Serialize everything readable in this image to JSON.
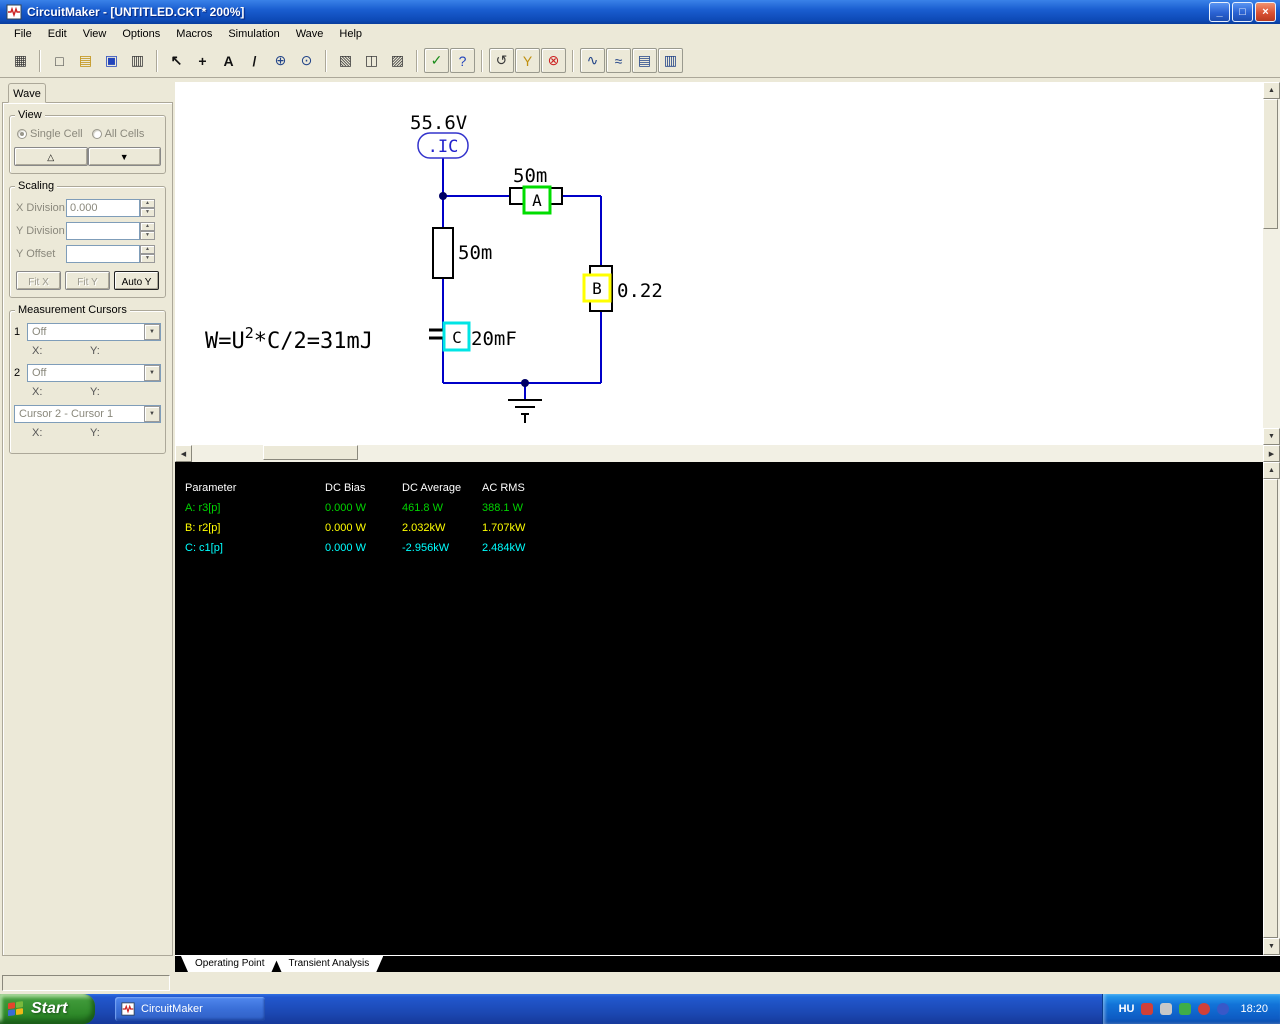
{
  "window": {
    "title": "CircuitMaker - [UNTITLED.CKT* 200%]",
    "controls": {
      "minimize": "_",
      "maximize": "□",
      "close": "×"
    }
  },
  "menu": {
    "items": [
      "File",
      "Edit",
      "View",
      "Options",
      "Macros",
      "Simulation",
      "Wave",
      "Help"
    ]
  },
  "toolbar": {
    "buttons": [
      {
        "icon": "parts-browser-icon",
        "glyph": "▦"
      },
      {
        "icon": "new-file-icon",
        "glyph": "□"
      },
      {
        "icon": "open-file-icon",
        "glyph": "▤"
      },
      {
        "icon": "save-icon",
        "glyph": "▣"
      },
      {
        "icon": "print-icon",
        "glyph": "▥"
      },
      {
        "icon": "arrow-tool-icon",
        "glyph": "↖"
      },
      {
        "icon": "wire-tool-icon",
        "glyph": "+"
      },
      {
        "icon": "text-tool-icon",
        "glyph": "A"
      },
      {
        "icon": "delete-tool-icon",
        "glyph": "/"
      },
      {
        "icon": "zoom-in-icon",
        "glyph": "⊕"
      },
      {
        "icon": "magnifier-icon",
        "glyph": "⊙"
      },
      {
        "icon": "fit-page-icon",
        "glyph": "▧"
      },
      {
        "icon": "split-view-icon",
        "glyph": "◫"
      },
      {
        "icon": "macro-icon",
        "glyph": "▨"
      },
      {
        "icon": "simulation-check-icon",
        "glyph": "✓"
      },
      {
        "icon": "help-icon",
        "glyph": "?"
      },
      {
        "icon": "reset-icon",
        "glyph": "↺"
      },
      {
        "icon": "probe-icon",
        "glyph": "Y"
      },
      {
        "icon": "stop-icon",
        "glyph": "⊗"
      },
      {
        "icon": "scope-icon",
        "glyph": "∿"
      },
      {
        "icon": "waveform-icon",
        "glyph": "≈"
      },
      {
        "icon": "analysis-icon",
        "glyph": "▤"
      },
      {
        "icon": "digital-display-icon",
        "glyph": "▥"
      }
    ]
  },
  "sidebar": {
    "tab": "Wave",
    "view": {
      "label": "View",
      "options": [
        {
          "label": "Single Cell",
          "selected": true
        },
        {
          "label": "All Cells",
          "selected": false
        }
      ],
      "up_glyph": "△",
      "down_glyph": "▼"
    },
    "scaling": {
      "label": "Scaling",
      "fields": [
        {
          "label": "X Division",
          "value": "0.000"
        },
        {
          "label": "Y Division",
          "value": ""
        },
        {
          "label": "Y Offset",
          "value": ""
        }
      ],
      "buttons": [
        {
          "label": "Fit X",
          "enabled": false
        },
        {
          "label": "Fit Y",
          "enabled": false
        },
        {
          "label": "Auto Y",
          "enabled": true
        }
      ]
    },
    "cursors": {
      "label": "Measurement Cursors",
      "cursor1": {
        "num": "1",
        "value": "Off"
      },
      "cursor2": {
        "num": "2",
        "value": "Off"
      },
      "diff_value": "Cursor 2 - Cursor 1",
      "x_label": "X:",
      "y_label": "Y:"
    }
  },
  "circuit": {
    "source_value": "55.6V",
    "ic_label": ".IC",
    "r_top_ref": "A",
    "r_top_value": "50m",
    "r_left_value": "50m",
    "r_right_ref": "B",
    "r_right_value": "0.22",
    "cap_ref": "C",
    "cap_value": "20mF",
    "annotation": {
      "pre": "W=U",
      "sup": "2",
      "post": "*C/2=31mJ"
    },
    "colors": {
      "wire": "#0000C8",
      "ref_a": "#00dd00",
      "ref_b": "#ffff00",
      "ref_c": "#00e5e5"
    }
  },
  "results": {
    "columns": [
      "Parameter",
      "DC Bias",
      "DC Average",
      "AC RMS"
    ],
    "rows": [
      {
        "name": "A: r3[p]",
        "dc_bias": "0.000 W",
        "dc_average": "461.8 W",
        "ac_rms": "388.1 W",
        "color": "#00d400"
      },
      {
        "name": "B: r2[p]",
        "dc_bias": "0.000 W",
        "dc_average": "2.032kW",
        "ac_rms": "1.707kW",
        "color": "#ffff00"
      },
      {
        "name": "C: c1[p]",
        "dc_bias": "0.000 W",
        "dc_average": "-2.956kW",
        "ac_rms": "2.484kW",
        "color": "#00ffff"
      }
    ],
    "tabs": [
      {
        "label": "Operating Point",
        "active": true
      },
      {
        "label": "Transient Analysis",
        "active": false
      }
    ]
  },
  "taskbar": {
    "start_label": "Start",
    "task_label": "CircuitMaker",
    "tray": {
      "language": "HU",
      "time": "18:20",
      "icon_colors": [
        "#d04038",
        "#c8c8c8",
        "#3fae49",
        "#d04038",
        "#3858c8"
      ]
    }
  },
  "ui": {
    "icons": {
      "scroll_up": "▲",
      "scroll_down": "▼",
      "scroll_left": "◀",
      "scroll_right": "▶",
      "combo_arrow": "▼",
      "spin_up": "▲",
      "spin_down": "▼"
    }
  }
}
